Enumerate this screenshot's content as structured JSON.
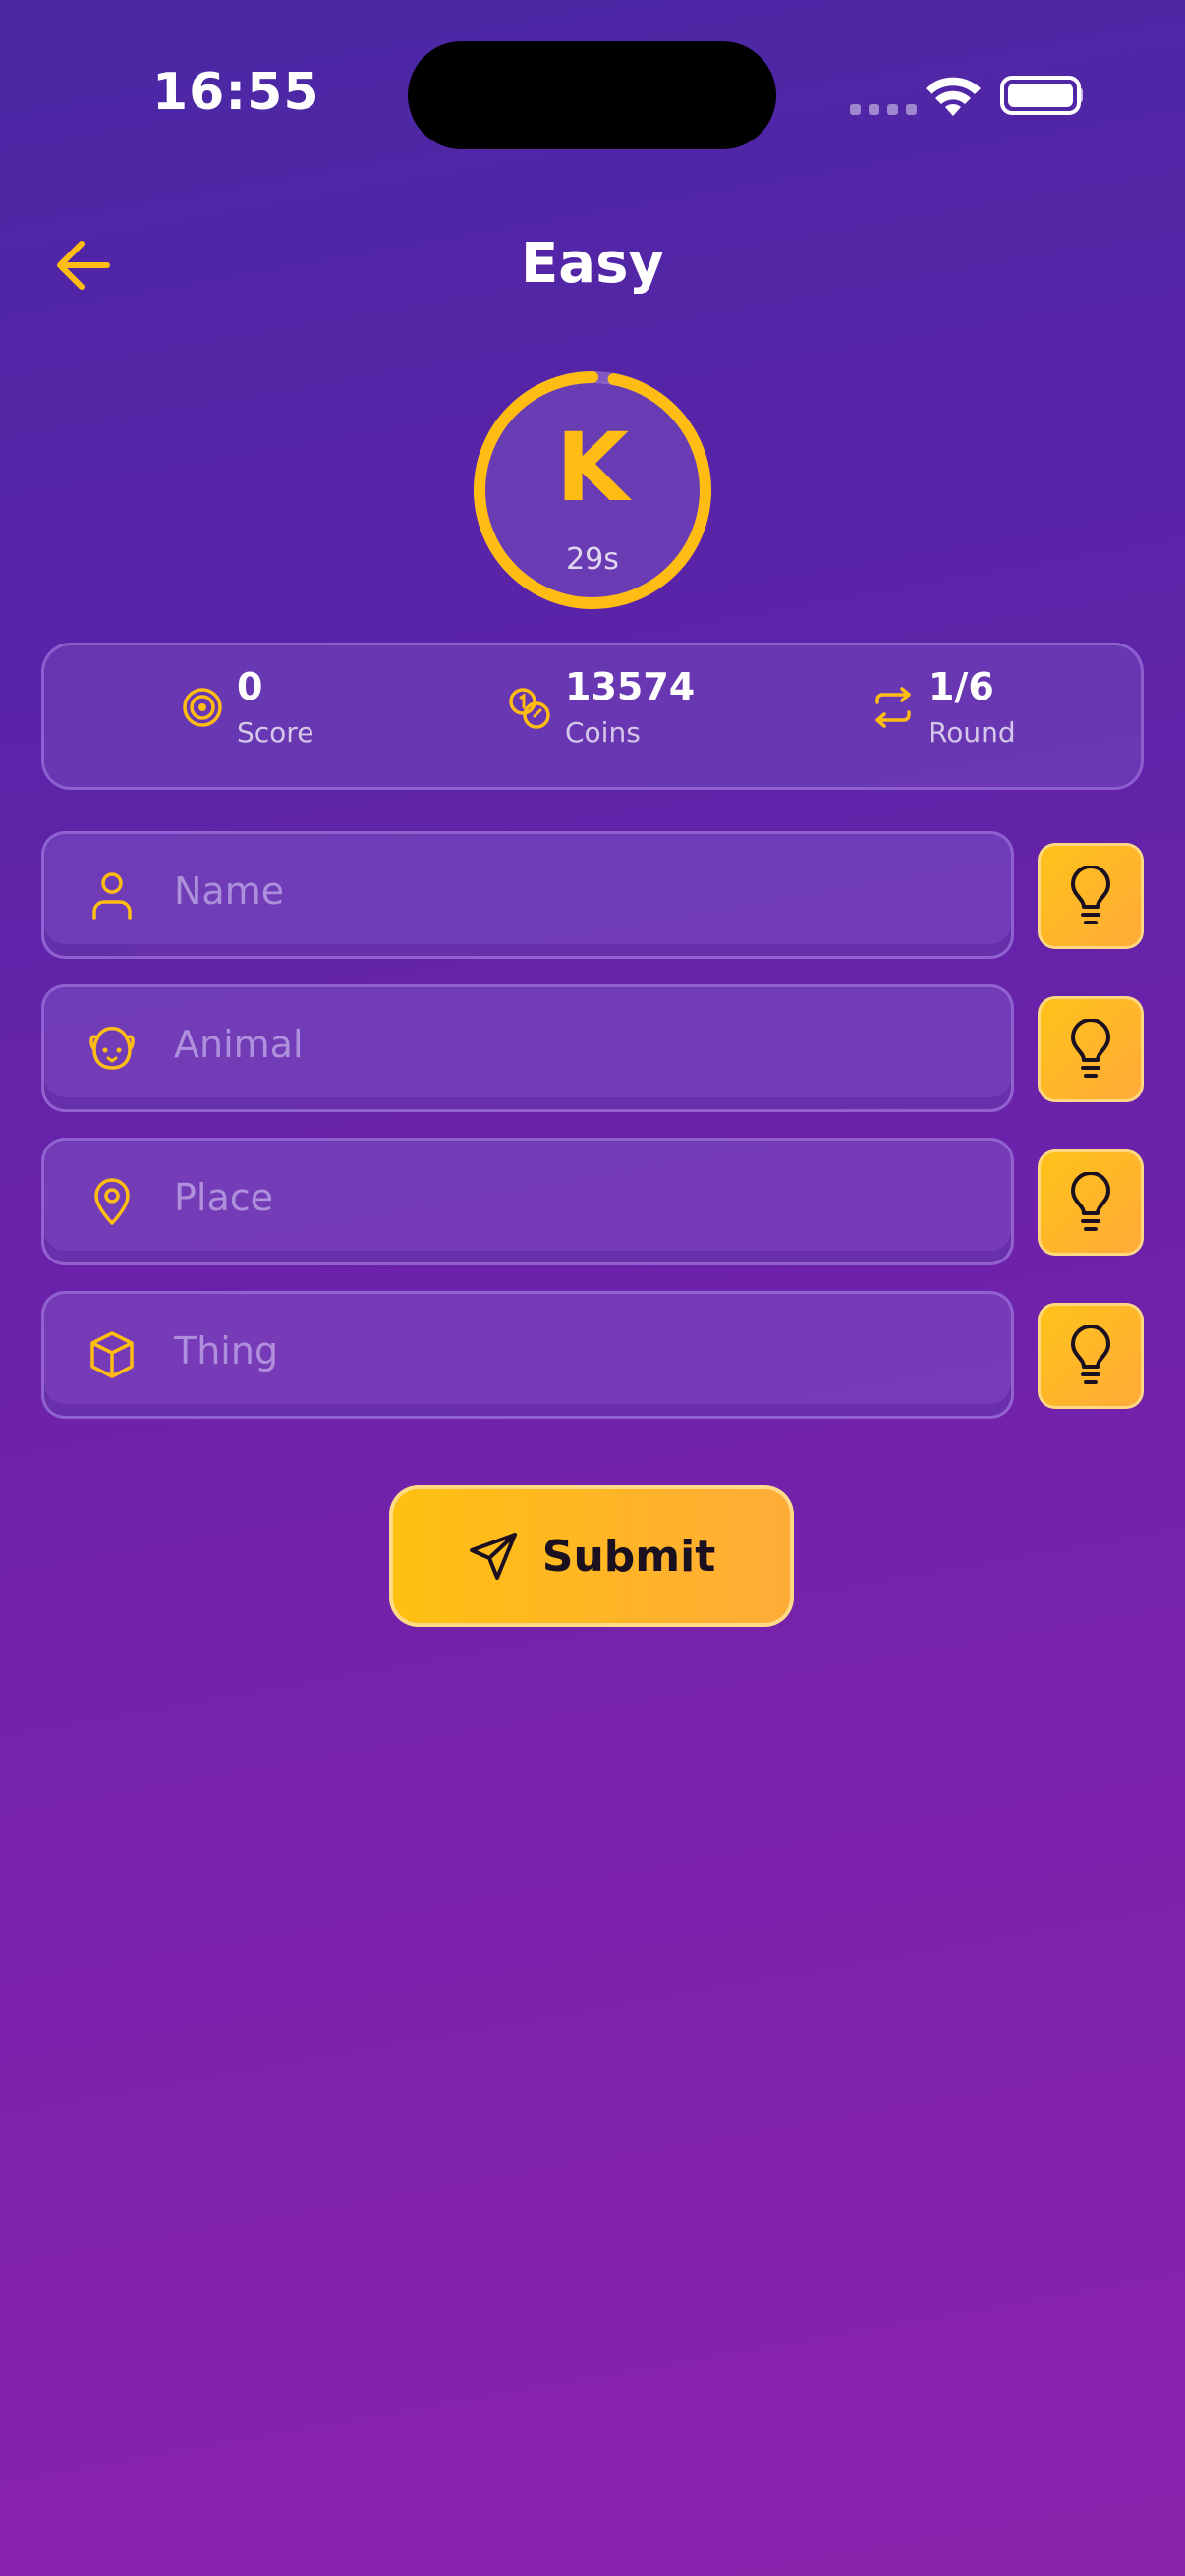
{
  "status_bar": {
    "time": "16:55"
  },
  "header": {
    "title": "Easy"
  },
  "timer": {
    "letter": "K",
    "seconds_label": "29s",
    "remaining_fraction": 0.97
  },
  "stats": [
    {
      "value": "0",
      "label": "Score",
      "icon": "target-icon"
    },
    {
      "value": "13574",
      "label": "Coins",
      "icon": "coins-icon"
    },
    {
      "value": "1/6",
      "label": "Round",
      "icon": "repeat-icon"
    }
  ],
  "fields": [
    {
      "placeholder": "Name",
      "icon": "person-icon",
      "value": ""
    },
    {
      "placeholder": "Animal",
      "icon": "dog-face-icon",
      "value": ""
    },
    {
      "placeholder": "Place",
      "icon": "location-pin-icon",
      "value": ""
    },
    {
      "placeholder": "Thing",
      "icon": "box-icon",
      "value": ""
    }
  ],
  "submit": {
    "label": "Submit",
    "icon": "send-icon"
  },
  "colors": {
    "accent": "#ffbd14",
    "background_top": "#4a28a4",
    "background_bottom": "#8b22ac"
  }
}
